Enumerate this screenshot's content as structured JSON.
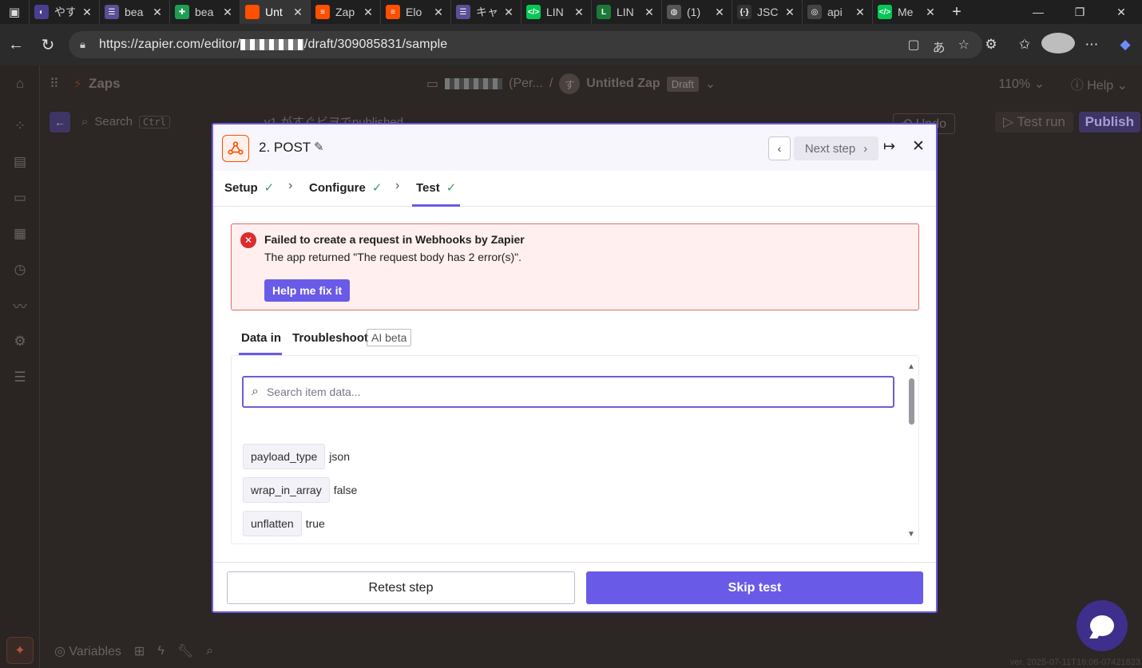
{
  "browser": {
    "tabs": [
      {
        "label": "やす",
        "color": "#4a3f8f",
        "glyph": "◐"
      },
      {
        "label": "bea",
        "color": "#5b4f95",
        "glyph": "☰"
      },
      {
        "label": "bea",
        "color": "#1e9e52",
        "glyph": "✚"
      },
      {
        "label": "Unt",
        "color": "#ff4f00",
        "glyph": "",
        "active": true
      },
      {
        "label": "Zap",
        "color": "#ff4f00",
        "glyph": "≡"
      },
      {
        "label": "Elo",
        "color": "#ff4f00",
        "glyph": "≡"
      },
      {
        "label": "キャ",
        "color": "#5b4f95",
        "glyph": "☰"
      },
      {
        "label": "LIN",
        "color": "#06c755",
        "glyph": "</>"
      },
      {
        "label": "LIN",
        "color": "#1b7a3a",
        "glyph": "L"
      },
      {
        "label": "(1)",
        "color": "#555555",
        "glyph": "◍"
      },
      {
        "label": "JSC",
        "color": "#333333",
        "glyph": "{·}"
      },
      {
        "label": "api",
        "color": "#444444",
        "glyph": "◎"
      },
      {
        "label": "Me",
        "color": "#06c755",
        "glyph": "</>"
      }
    ],
    "url_prefix": "https://zapier.com/editor/",
    "url_suffix": "/draft/309085831/sample"
  },
  "app": {
    "brand": "Zaps",
    "breadcrumb_suffix": "(Per...",
    "zap_avatar": "す",
    "zap_name": "Untitled Zap",
    "status_badge": "Draft",
    "zoom": "110%",
    "help": "Help",
    "search_label": "Search",
    "search_shortcut": "Ctrl",
    "version_line": "v1 がすぐビヲでpublished",
    "undo": "Undo",
    "test_run": "Test run",
    "publish": "Publish",
    "variables": "Variables",
    "version_footer": "ver. 2025-07-11T16:06-07421823"
  },
  "modal": {
    "title": "2. POST",
    "next_step": "Next step",
    "steps": [
      {
        "label": "Setup"
      },
      {
        "label": "Configure"
      },
      {
        "label": "Test"
      }
    ],
    "error": {
      "title": "Failed to create a request in Webhooks by Zapier",
      "message": "The app returned \"The request body has 2 error(s)\".",
      "fix_button": "Help me fix it"
    },
    "subtabs": {
      "data_in": "Data in",
      "troubleshoot": "Troubleshoot",
      "beta_badge": "AI beta"
    },
    "search_placeholder": "Search item data...",
    "items": [
      {
        "key": "payload_type",
        "value": "json"
      },
      {
        "key": "wrap_in_array",
        "value": "false"
      },
      {
        "key": "unflatten",
        "value": "true"
      }
    ],
    "retest_button": "Retest step",
    "skip_button": "Skip test"
  },
  "colors": {
    "accent": "#695be8",
    "error_border": "#e26b63",
    "error_bg": "#fff0ef",
    "success": "#2fa362",
    "brand_orange": "#ff4f00"
  }
}
